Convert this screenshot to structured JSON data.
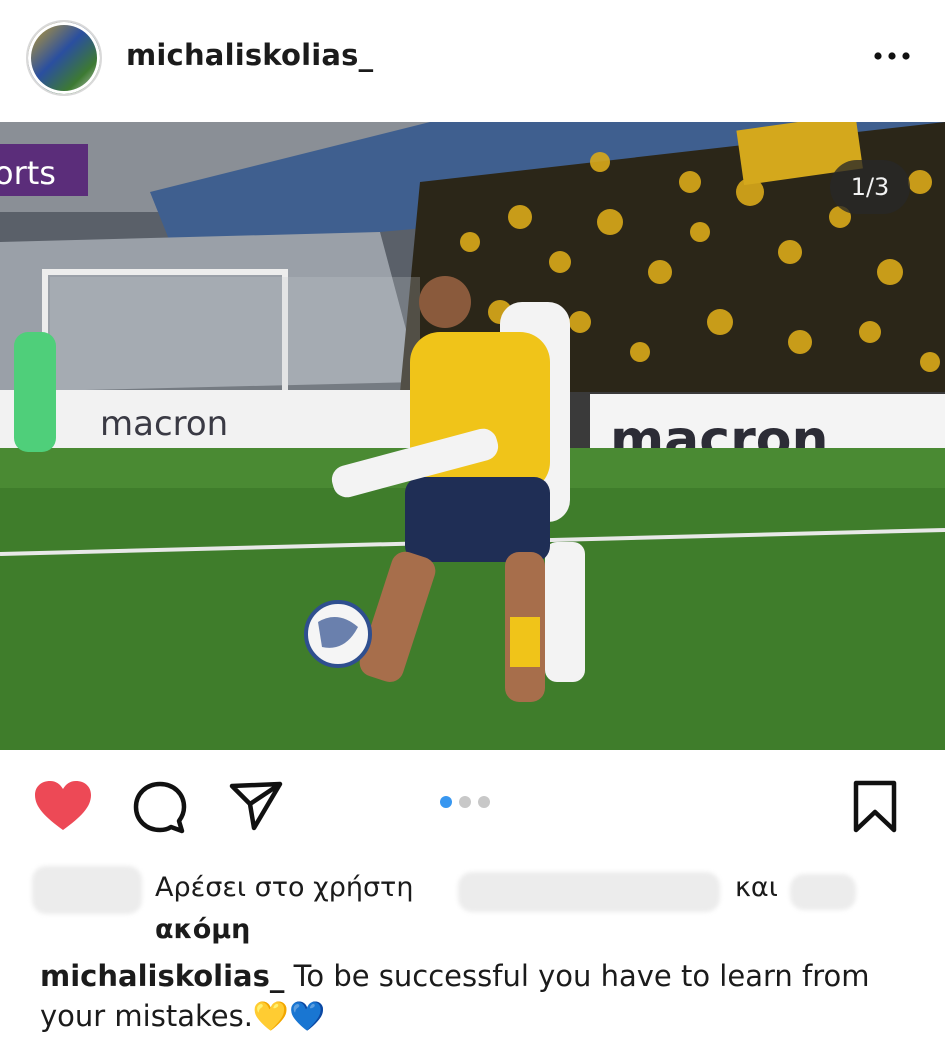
{
  "header": {
    "username": "michaliskolias_"
  },
  "media": {
    "counter": "1/3",
    "carousel": {
      "total": 3,
      "current": 1
    }
  },
  "likes": {
    "liked_by_prefix": "Αρέσει στο χρήστη",
    "and": "και",
    "more": "ακόμη"
  },
  "caption": {
    "username": "michaliskolias_",
    "text": "To be successful you have to learn from your mistakes.",
    "emoji": "💛💙"
  },
  "colors": {
    "heart": "#ed4956",
    "active_dot": "#3897f0"
  }
}
